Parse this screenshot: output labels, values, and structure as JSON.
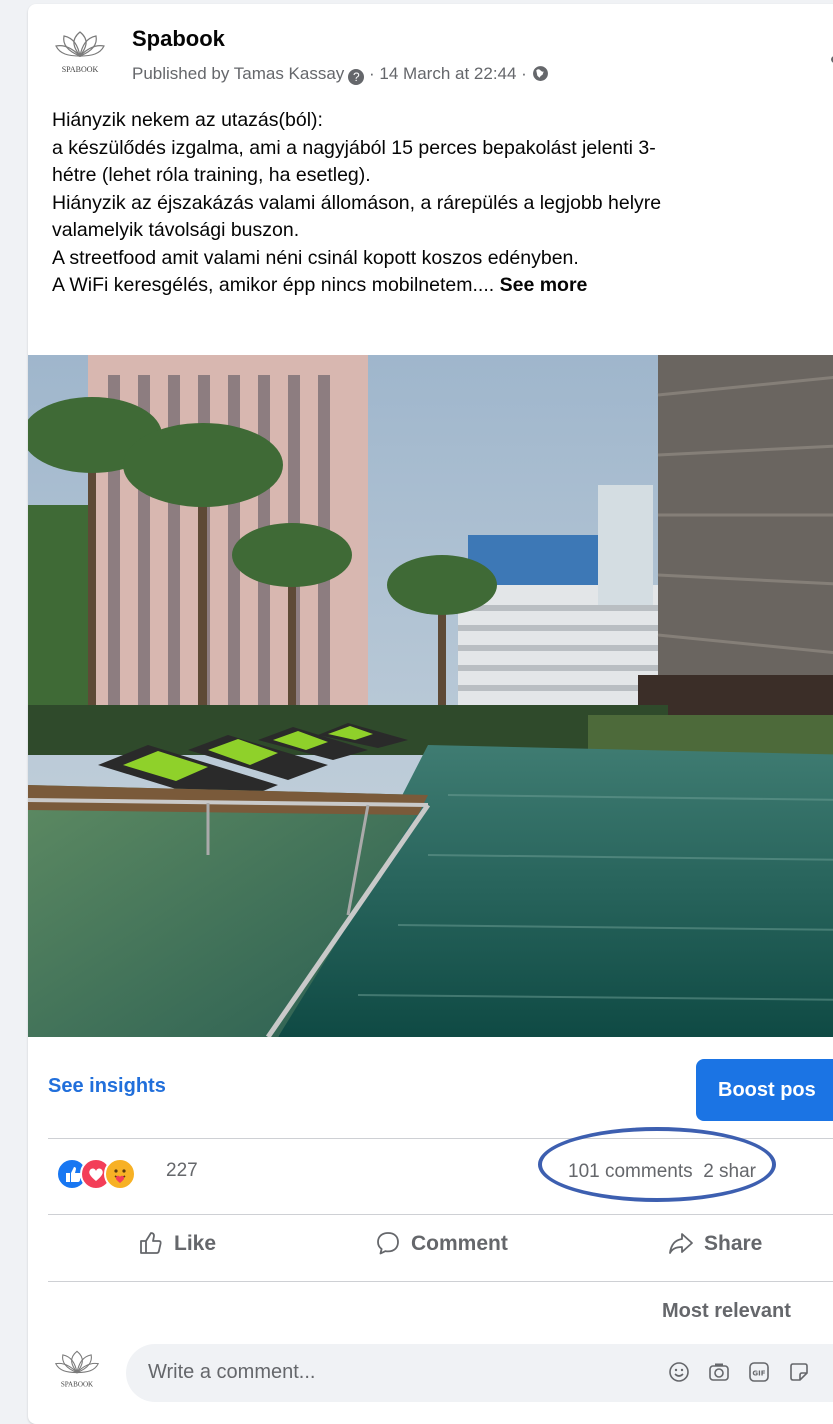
{
  "post": {
    "page_name": "Spabook",
    "avatar_text": "SPABOOK",
    "published_by": "Published by Tamas Kassay",
    "date": " · 14 March at 22:44 · ",
    "text_lines": [
      "Hiányzik nekem az utazás(ból):",
      "a készülődés izgalma, ami a nagyjából 15 perces bepakolást jelenti 3-",
      "hétre (lehet róla training, ha esetleg).",
      "Hiányzik az éjszakázás valami állomáson, a rárepülés a legjobb helyre",
      "valamelyik távolsági buszon.",
      "A streetfood amit valami néni csinál kopott koszos edényben.",
      "A WiFi keresgélés, amikor épp nincs mobilnetem.... "
    ],
    "see_more": "See more"
  },
  "insights": {
    "see_insights": "See insights",
    "boost": "Boost pos"
  },
  "stats": {
    "reaction_count": "227",
    "comments": "101 comments",
    "shares": "2 shar"
  },
  "actions": {
    "like": "Like",
    "comment": "Comment",
    "share": "Share"
  },
  "comments": {
    "sort": "Most relevant",
    "placeholder": "Write a comment..."
  },
  "colors": {
    "accent": "#1b74e4",
    "link": "#216fdb",
    "secondary_text": "#65676b",
    "highlight_oval": "#3d5fb0"
  },
  "icons": {
    "question": "?",
    "more": "•••"
  }
}
